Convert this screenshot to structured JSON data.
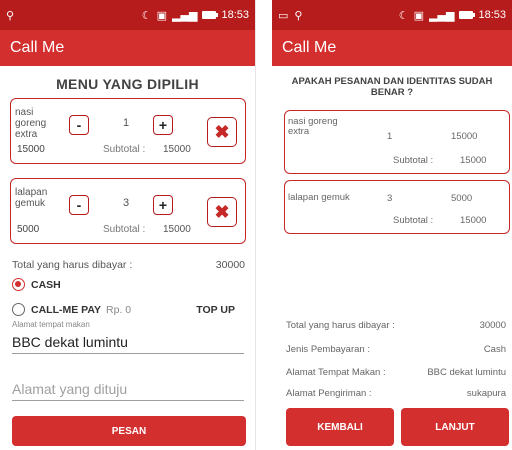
{
  "status": {
    "time": "18:53"
  },
  "app": {
    "title": "Call Me"
  },
  "order": {
    "heading": "MENU YANG DIPILIH",
    "subtotal_label": "Subtotal :",
    "minus": "-",
    "plus": "+",
    "remove": "✖",
    "items": [
      {
        "name": "nasi goreng extra",
        "qty": "1",
        "price": "15000",
        "subtotal": "15000"
      },
      {
        "name": "lalapan gemuk",
        "qty": "3",
        "price": "5000",
        "subtotal": "15000"
      }
    ],
    "total_label": "Total yang harus dibayar :",
    "total_value": "30000"
  },
  "payment": {
    "cash_label": "CASH",
    "callme_label": "CALL-ME PAY",
    "callme_balance": "Rp. 0",
    "topup_label": "TOP UP",
    "selected": "CASH"
  },
  "address": {
    "pickup_label": "Alamat tempat makan",
    "pickup_value": "BBC dekat lumintu",
    "dest_placeholder": "Alamat yang dituju"
  },
  "order_button": "PESAN",
  "confirm": {
    "heading": "APAKAH PESANAN DAN IDENTITAS SUDAH BENAR ?",
    "subtotal_label": "Subtotal :",
    "items": [
      {
        "name": "nasi goreng extra",
        "qty": "1",
        "price": "15000",
        "subtotal": "15000"
      },
      {
        "name": "lalapan gemuk",
        "qty": "3",
        "price": "5000",
        "subtotal": "15000"
      }
    ],
    "summary": [
      {
        "label": "Total yang harus dibayar :",
        "value": "30000"
      },
      {
        "label": "Jenis Pembayaran :",
        "value": "Cash"
      },
      {
        "label": "Alamat Tempat Makan :",
        "value": "BBC dekat lumintu"
      },
      {
        "label": "Alamat Pengiriman :",
        "value": "sukapura"
      }
    ],
    "back_button": "KEMBALI",
    "next_button": "LANJUT"
  }
}
